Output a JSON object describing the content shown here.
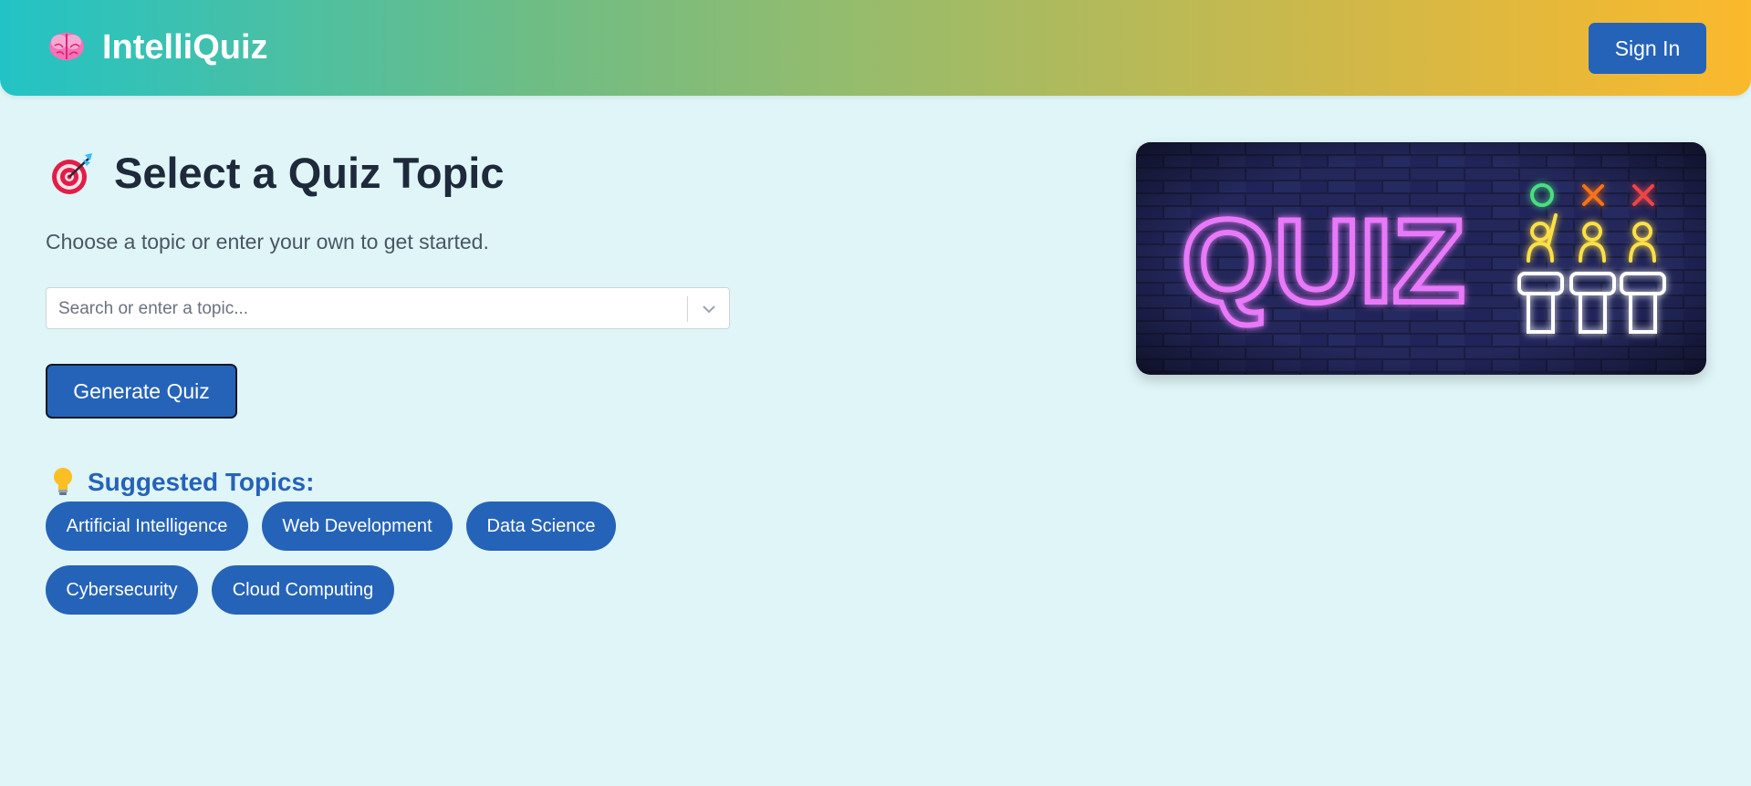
{
  "header": {
    "brand_icon": "brain-icon",
    "title": "IntelliQuiz",
    "signin_label": "Sign In"
  },
  "main": {
    "heading_icon": "target-icon",
    "title": "Select a Quiz Topic",
    "subtitle": "Choose a topic or enter your own to get started.",
    "search": {
      "placeholder": "Search or enter a topic...",
      "value": ""
    },
    "generate_label": "Generate Quiz",
    "suggested": {
      "icon": "lightbulb-icon",
      "title": "Suggested Topics:",
      "topics": [
        "Artificial Intelligence",
        "Web Development",
        "Data Science",
        "Cybersecurity",
        "Cloud Computing"
      ]
    }
  },
  "banner": {
    "image": "neon-quiz-sign",
    "text": "QUIZ"
  },
  "colors": {
    "accent": "#2563b9",
    "background": "#dff5f7",
    "header_gradient_start": "#22c3c6",
    "header_gradient_end": "#fbb92c"
  }
}
